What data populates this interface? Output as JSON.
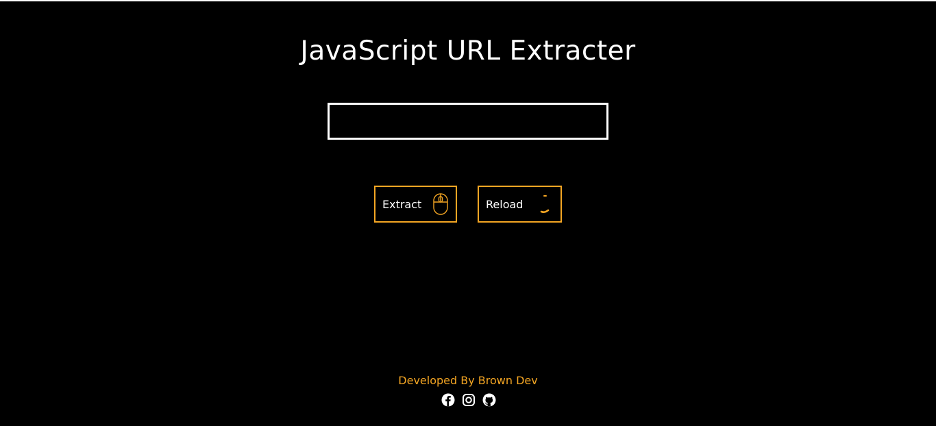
{
  "page": {
    "title": "JavaScript URL Extracter"
  },
  "url_input": {
    "value": "",
    "placeholder": ""
  },
  "buttons": {
    "extract_label": "Extract",
    "extract_icon": "mouse-icon",
    "reload_label": "Reload",
    "reload_icon": "loading-spinner-icon"
  },
  "footer": {
    "credit": "Developed By Brown Dev",
    "social_icons": [
      "facebook-icon",
      "instagram-icon",
      "github-icon"
    ]
  },
  "colors": {
    "background": "#000000",
    "text": "#ffffff",
    "accent": "#f5a623"
  }
}
